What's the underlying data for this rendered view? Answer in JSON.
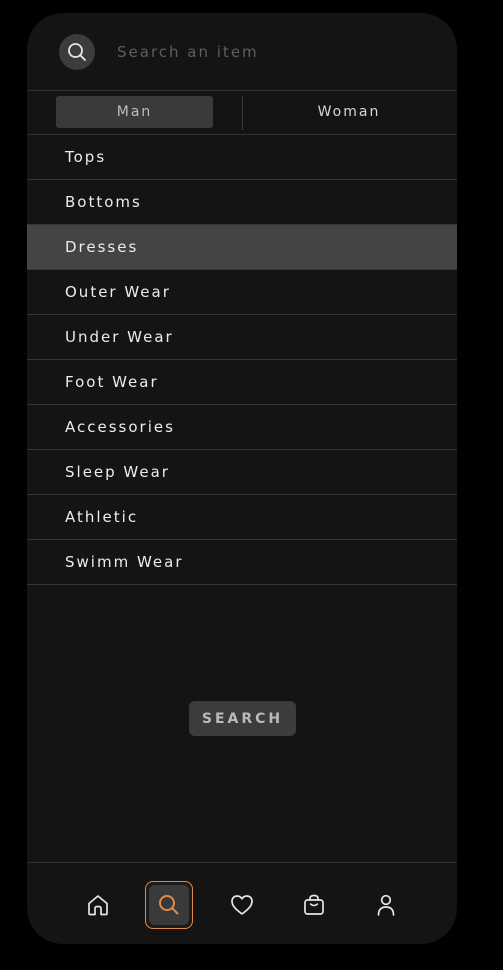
{
  "search": {
    "placeholder": "Search an item",
    "value": ""
  },
  "gender_tabs": [
    {
      "label": "Man",
      "selected": true
    },
    {
      "label": "Woman",
      "selected": false
    }
  ],
  "categories": [
    {
      "label": "Tops",
      "active": false
    },
    {
      "label": "Bottoms",
      "active": false
    },
    {
      "label": "Dresses",
      "active": true
    },
    {
      "label": "Outer Wear",
      "active": false
    },
    {
      "label": "Under Wear",
      "active": false
    },
    {
      "label": "Foot Wear",
      "active": false
    },
    {
      "label": "Accessories",
      "active": false
    },
    {
      "label": "Sleep Wear",
      "active": false
    },
    {
      "label": "Athletic",
      "active": false
    },
    {
      "label": "Swimm Wear",
      "active": false
    }
  ],
  "search_button": {
    "label": "SEARCH"
  },
  "bottom_nav": {
    "items": [
      {
        "icon": "home-icon",
        "active": false
      },
      {
        "icon": "search-icon",
        "active": true
      },
      {
        "icon": "heart-icon",
        "active": false
      },
      {
        "icon": "shopping-bag-icon",
        "active": false
      },
      {
        "icon": "user-icon",
        "active": false
      }
    ]
  },
  "colors": {
    "background": "#000000",
    "surface": "#141414",
    "selected_row": "#444444",
    "accent": "#e08a4a",
    "text": "#ececec"
  }
}
